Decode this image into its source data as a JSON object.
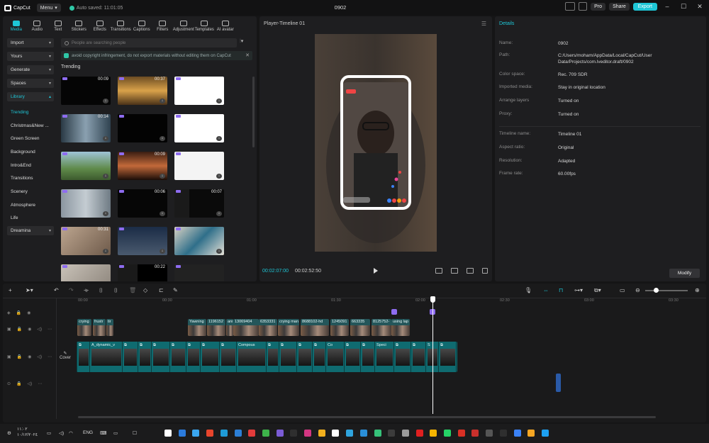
{
  "titlebar": {
    "app_name": "CapCut",
    "menu_label": "Menu",
    "autosave": "Auto saved: 11:01:05",
    "project_title": "0902",
    "pro_label": "Pro",
    "share_label": "Share",
    "export_label": "Export"
  },
  "tools": [
    {
      "label": "Media",
      "icon": "media-icon"
    },
    {
      "label": "Audio",
      "icon": "audio-icon"
    },
    {
      "label": "Text",
      "icon": "text-icon"
    },
    {
      "label": "Stickers",
      "icon": "sticker-icon"
    },
    {
      "label": "Effects",
      "icon": "effects-icon"
    },
    {
      "label": "Transitions",
      "icon": "transitions-icon"
    },
    {
      "label": "Captions",
      "icon": "captions-icon"
    },
    {
      "label": "Filters",
      "icon": "filters-icon"
    },
    {
      "label": "Adjustment",
      "icon": "adjustment-icon"
    },
    {
      "label": "Templates",
      "icon": "templates-icon"
    },
    {
      "label": "AI avatar",
      "icon": "ai-avatar-icon"
    }
  ],
  "leftnav": {
    "import": "Import",
    "yours": "Yours",
    "generate": "Generate",
    "spaces": "Spaces",
    "library": "Library",
    "sub": [
      "Trending",
      "Christmas&New ...",
      "Green Screen",
      "Background",
      "Intro&End",
      "Transitions",
      "Scenery",
      "Atmosphere",
      "Life"
    ],
    "dreamina": "Dreamina"
  },
  "search": {
    "placeholder": "People are searching people"
  },
  "notice": "avoid copyright infringement, do not export materials without editing them on CapCut",
  "trending_title": "Trending",
  "media_durations": [
    "00:09",
    "00:37",
    "",
    "00:14",
    "",
    "",
    "",
    "00:09",
    "",
    "",
    "00:06",
    "00:07",
    "00:31",
    "",
    "",
    "",
    "00:22",
    ""
  ],
  "player": {
    "title": "Player-Timeline 01",
    "current_time": "00:02:07:00",
    "total_time": "00:02:52:50"
  },
  "details": {
    "title": "Details",
    "rows": [
      {
        "label": "Name:",
        "value": "0902"
      },
      {
        "label": "Path:",
        "value": "C:/Users/moham/AppData/Local/CapCut/User Data/Projects/com.lveditor.draft/0902"
      },
      {
        "label": "Color space:",
        "value": "Rec. 709 SDR"
      },
      {
        "label": "Imported media:",
        "value": "Stay in original location"
      },
      {
        "label": "Arrange layers",
        "value": "Turned on"
      },
      {
        "label": "Proxy:",
        "value": "Turned on"
      },
      {
        "label": "Timeline name:",
        "value": "Timeline 01"
      },
      {
        "label": "Aspect ratio:",
        "value": "Original"
      },
      {
        "label": "Resolution:",
        "value": "Adapted"
      },
      {
        "label": "Frame rate:",
        "value": "60.00fps"
      }
    ],
    "modify_label": "Modify"
  },
  "timeline": {
    "ruler": [
      "00:00",
      "00:30",
      "01:00",
      "01:30",
      "02:00",
      "02:30",
      "03:00",
      "03:30"
    ],
    "cover_label": "Cover",
    "upper_clips": [
      "crying",
      "frustr",
      "tir",
      "Yawning",
      "1196152",
      "ani",
      "13069404",
      "6353331",
      "crying man",
      "8688102-hd",
      "1245091",
      "663335",
      "8125752-",
      "using lap"
    ],
    "main_clips": [
      "A_dynamic_v",
      "Compous",
      "Co",
      "Speci",
      "S",
      "Sp"
    ]
  },
  "taskbar": {
    "time": "١١:٠٢",
    "date": "١٠/١٢/٢٠٢٤",
    "lang": "ENG"
  },
  "colors": {
    "accent": "#1ec6d6",
    "track": "#0f6b70",
    "marker": "#8e6cf0"
  }
}
